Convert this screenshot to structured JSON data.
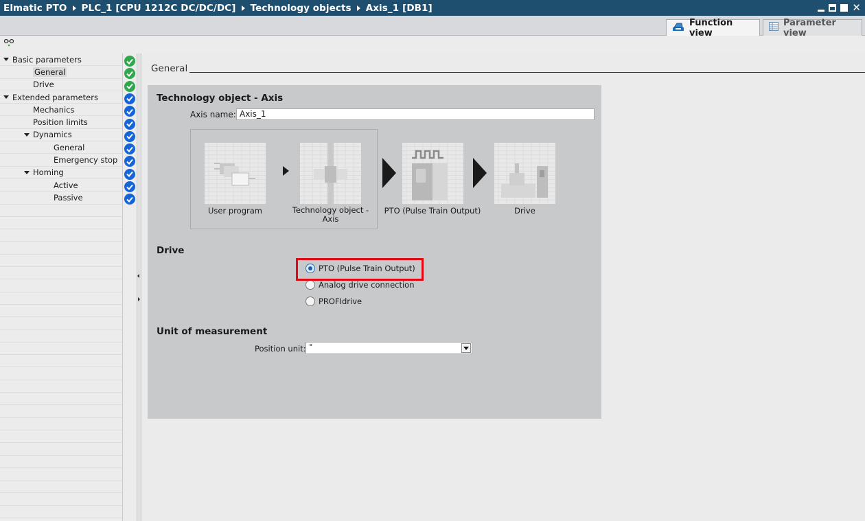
{
  "titlebar": {
    "crumbs": [
      "Elmatic PTO",
      "PLC_1 [CPU 1212C DC/DC/DC]",
      "Technology objects",
      "Axis_1 [DB1]"
    ],
    "close_glyph": "✕"
  },
  "tabs": {
    "function_view": "Function view",
    "parameter_view": "Parameter view"
  },
  "tree": {
    "items": [
      {
        "label": "Basic parameters",
        "level": 0,
        "expanded": true,
        "status": "green"
      },
      {
        "label": "General",
        "level": 1,
        "selected": true,
        "status": "green"
      },
      {
        "label": "Drive",
        "level": 1,
        "status": "green"
      },
      {
        "label": "Extended parameters",
        "level": 0,
        "expanded": true,
        "status": "blue"
      },
      {
        "label": "Mechanics",
        "level": 1,
        "status": "blue"
      },
      {
        "label": "Position limits",
        "level": 1,
        "status": "blue"
      },
      {
        "label": "Dynamics",
        "level": 1,
        "expanded": true,
        "status": "blue"
      },
      {
        "label": "General",
        "level": 2,
        "status": "blue"
      },
      {
        "label": "Emergency stop",
        "level": 2,
        "status": "blue"
      },
      {
        "label": "Homing",
        "level": 1,
        "expanded": true,
        "status": "blue"
      },
      {
        "label": "Active",
        "level": 2,
        "status": "blue"
      },
      {
        "label": "Passive",
        "level": 2,
        "status": "blue"
      }
    ]
  },
  "main": {
    "section_title": "General",
    "tech_object": {
      "title": "Technology object - Axis",
      "axis_name_label": "Axis name:",
      "axis_name_value": "Axis_1"
    },
    "flow": {
      "user_program": "User program",
      "tech_object_axis": "Technology object - Axis",
      "pto": "PTO (Pulse Train Output)",
      "drive": "Drive"
    },
    "drive_section": {
      "title": "Drive",
      "options": [
        {
          "label": "PTO (Pulse Train Output)",
          "selected": true
        },
        {
          "label": "Analog drive connection",
          "selected": false
        },
        {
          "label": "PROFIdrive",
          "selected": false
        }
      ]
    },
    "unit_section": {
      "title": "Unit of measurement",
      "position_unit_label": "Position unit:",
      "position_unit_value": "°"
    }
  },
  "colors": {
    "titlebar": "#1f4f6f",
    "check_green": "#2ea84a",
    "check_blue": "#1565d8",
    "highlight_red": "#e30613",
    "panel": "#c7c9cb"
  }
}
